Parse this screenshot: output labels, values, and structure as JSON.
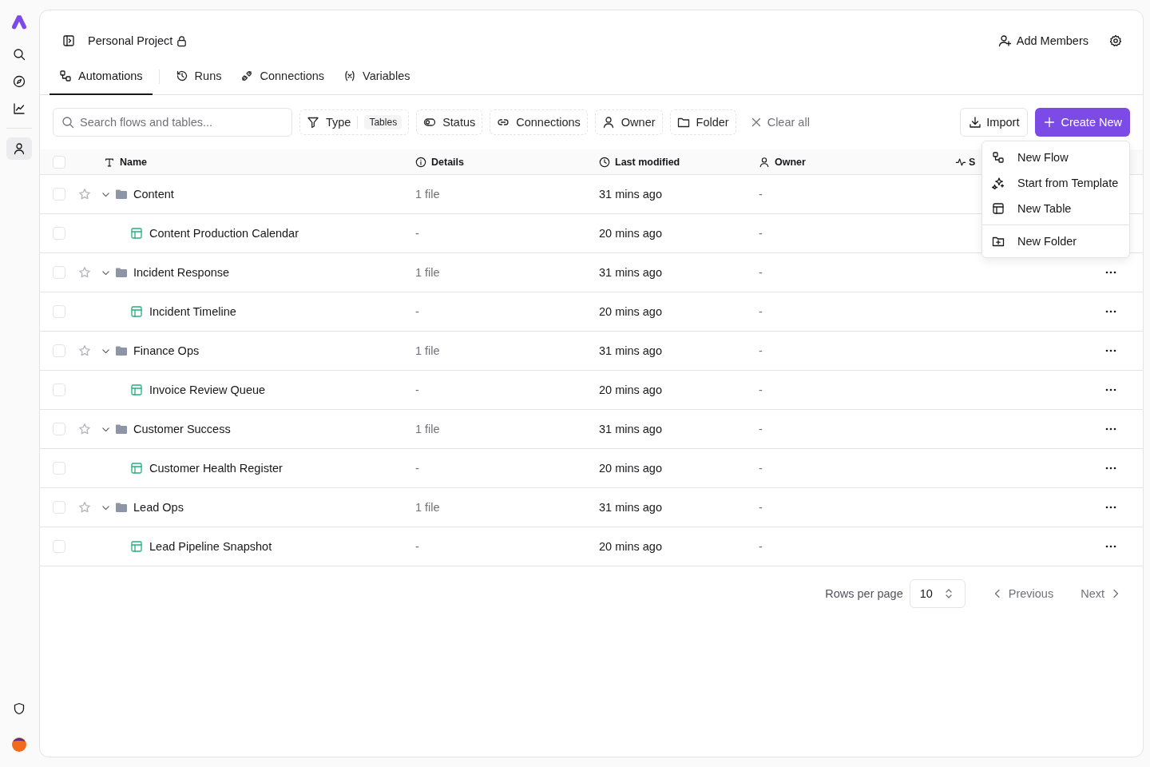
{
  "sidebar": {
    "items": [
      {
        "kind": "search",
        "selected": false
      },
      {
        "kind": "explore",
        "selected": false
      },
      {
        "kind": "chart",
        "selected": false
      },
      {
        "kind": "user",
        "selected": true
      }
    ],
    "bottom": [
      {
        "kind": "shield"
      },
      {
        "kind": "avatar"
      }
    ]
  },
  "header": {
    "title": "Personal Project",
    "locked": true,
    "add_members": "Add Members"
  },
  "tabs": [
    {
      "kind": "flow",
      "label": "Automations",
      "selected": true
    },
    {
      "kind": "history",
      "label": "Runs",
      "selected": false
    },
    {
      "kind": "plug",
      "label": "Connections",
      "selected": false
    },
    {
      "kind": "variable",
      "label": "Variables",
      "selected": false
    }
  ],
  "search": {
    "placeholder": "Search flows and tables..."
  },
  "filters": [
    {
      "kind": "type",
      "label": "Type",
      "value": "Tables"
    },
    {
      "kind": "status",
      "label": "Status"
    },
    {
      "kind": "link",
      "label": "Connections"
    },
    {
      "kind": "user",
      "label": "Owner"
    },
    {
      "kind": "folder",
      "label": "Folder"
    }
  ],
  "clear_all": "Clear all",
  "import_button": "Import",
  "create_button": "Create New",
  "table": {
    "columns": [
      {
        "kind": "text",
        "label": "Name"
      },
      {
        "kind": "info",
        "label": "Details"
      },
      {
        "kind": "clock",
        "label": "Last modified"
      },
      {
        "kind": "user",
        "label": "Owner"
      },
      {
        "kind": "activity",
        "label": "S"
      }
    ],
    "all_checked": false,
    "rows": [
      {
        "kind": "folder",
        "name": "Content",
        "checked": false,
        "starred": false,
        "expanded": true,
        "details": "1 file",
        "modified": "31 mins ago",
        "owner": "-",
        "children": [
          {
            "kind": "table",
            "name": "Content Production Calendar",
            "checked": false,
            "details": "-",
            "modified": "20 mins ago",
            "owner": "-"
          }
        ]
      },
      {
        "kind": "folder",
        "name": "Incident Response",
        "checked": false,
        "starred": false,
        "expanded": true,
        "details": "1 file",
        "modified": "31 mins ago",
        "owner": "-",
        "children": [
          {
            "kind": "table",
            "name": "Incident Timeline",
            "checked": false,
            "details": "-",
            "modified": "20 mins ago",
            "owner": "-"
          }
        ]
      },
      {
        "kind": "folder",
        "name": "Finance Ops",
        "checked": false,
        "starred": false,
        "expanded": true,
        "details": "1 file",
        "modified": "31 mins ago",
        "owner": "-",
        "children": [
          {
            "kind": "table",
            "name": "Invoice Review Queue",
            "checked": false,
            "details": "-",
            "modified": "20 mins ago",
            "owner": "-"
          }
        ]
      },
      {
        "kind": "folder",
        "name": "Customer Success",
        "checked": false,
        "starred": false,
        "expanded": true,
        "details": "1 file",
        "modified": "31 mins ago",
        "owner": "-",
        "children": [
          {
            "kind": "table",
            "name": "Customer Health Register",
            "checked": false,
            "details": "-",
            "modified": "20 mins ago",
            "owner": "-"
          }
        ]
      },
      {
        "kind": "folder",
        "name": "Lead Ops",
        "checked": false,
        "starred": false,
        "expanded": true,
        "details": "1 file",
        "modified": "31 mins ago",
        "owner": "-",
        "children": [
          {
            "kind": "table",
            "name": "Lead Pipeline Snapshot",
            "checked": false,
            "details": "-",
            "modified": "20 mins ago",
            "owner": "-"
          }
        ]
      }
    ]
  },
  "create_menu": {
    "sections": [
      [
        {
          "kind": "flow",
          "label": "New Flow"
        },
        {
          "kind": "sparkle",
          "label": "Start from Template"
        },
        {
          "kind": "table",
          "label": "New Table"
        }
      ],
      [
        {
          "kind": "folder-plus",
          "label": "New Folder"
        }
      ]
    ]
  },
  "pagination": {
    "rows_per_page_label": "Rows per page",
    "rows_per_page": "10",
    "previous": {
      "label": "Previous",
      "disabled": true
    },
    "next": {
      "label": "Next",
      "disabled": true
    }
  }
}
